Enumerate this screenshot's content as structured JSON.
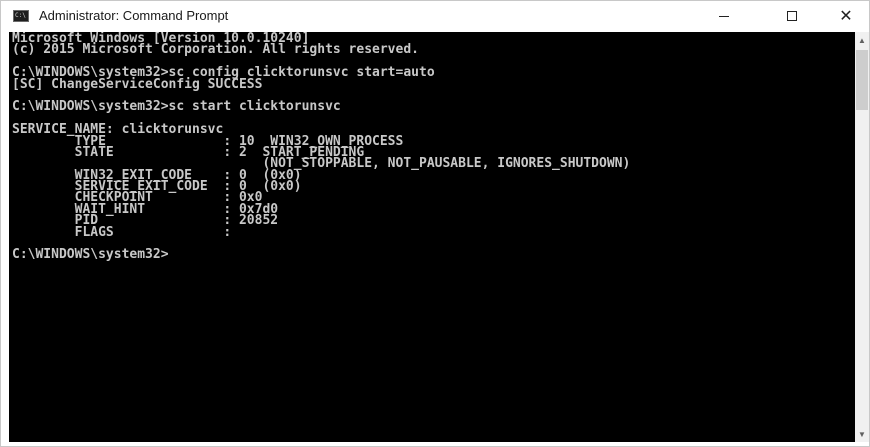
{
  "window": {
    "title": "Administrator: Command Prompt",
    "icon": "cmd-icon",
    "controls": {
      "minimize": "—",
      "maximize": "☐",
      "close": "✕"
    }
  },
  "console": {
    "lines": [
      "Microsoft Windows [Version 10.0.10240]",
      "(c) 2015 Microsoft Corporation. All rights reserved.",
      "",
      "C:\\WINDOWS\\system32>sc config clicktorunsvc start=auto",
      "[SC] ChangeServiceConfig SUCCESS",
      "",
      "C:\\WINDOWS\\system32>sc start clicktorunsvc",
      "",
      "SERVICE_NAME: clicktorunsvc",
      "        TYPE               : 10  WIN32_OWN_PROCESS",
      "        STATE              : 2  START_PENDING",
      "                                (NOT_STOPPABLE, NOT_PAUSABLE, IGNORES_SHUTDOWN)",
      "        WIN32_EXIT_CODE    : 0  (0x0)",
      "        SERVICE_EXIT_CODE  : 0  (0x0)",
      "        CHECKPOINT         : 0x0",
      "        WAIT_HINT          : 0x7d0",
      "        PID                : 20852",
      "        FLAGS              :",
      "",
      "C:\\WINDOWS\\system32>"
    ]
  },
  "colors": {
    "console_bg": "#000000",
    "console_text": "#c8c8c8",
    "titlebar_bg": "#ffffff"
  }
}
